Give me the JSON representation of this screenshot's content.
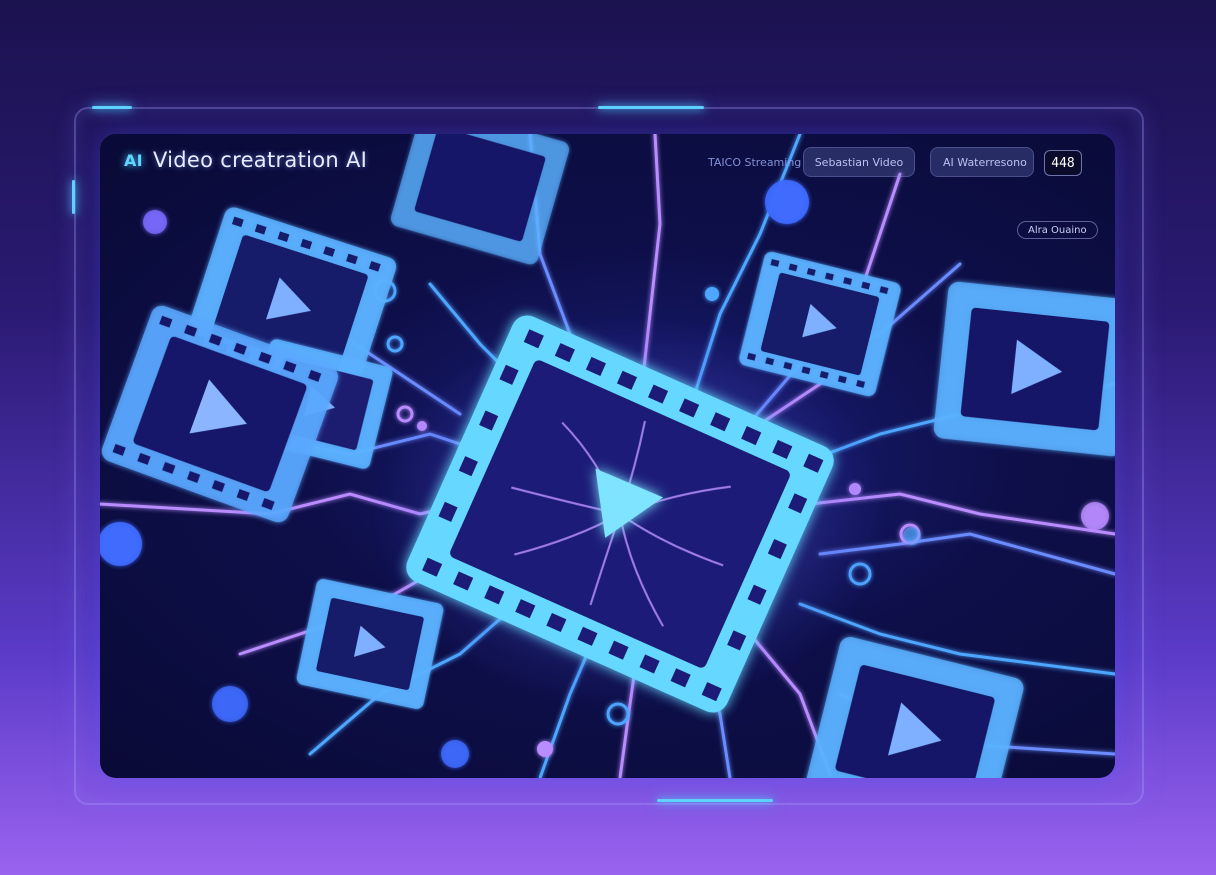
{
  "header": {
    "brand_mark": "AI",
    "title": "Video creatration AI",
    "nav_link": "TAICO Streaming",
    "button_1": "Sebastian Video",
    "button_2": "AI Waterresono",
    "count_badge": "448"
  },
  "sub_button": "Alra Ouaino",
  "colors": {
    "accent_cyan": "#5fd3ff",
    "accent_blue": "#4f8cff",
    "accent_purple": "#b78cff",
    "background_top": "#1b1250",
    "background_bottom": "#9a63ef"
  },
  "icons": [
    "film-frame-icon",
    "play-icon"
  ]
}
